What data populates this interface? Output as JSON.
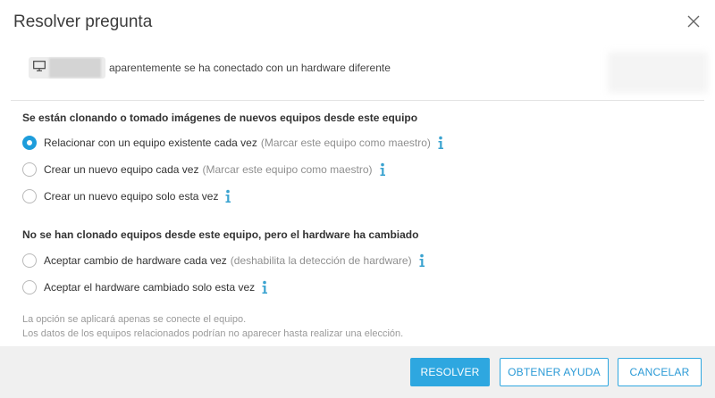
{
  "dialog": {
    "title": "Resolver pregunta",
    "close_icon": "close-icon"
  },
  "device": {
    "icon": "monitor-icon",
    "message": "aparentemente se ha conectado con un hardware diferente"
  },
  "section1": {
    "title": "Se están clonando o tomado imágenes de nuevos equipos desde este equipo",
    "options": [
      {
        "label": "Relacionar con un equipo existente cada vez",
        "hint": "(Marcar este equipo como maestro)",
        "checked": true
      },
      {
        "label": "Crear un nuevo equipo cada vez",
        "hint": "(Marcar este equipo como maestro)",
        "checked": false
      },
      {
        "label": "Crear un nuevo equipo solo esta vez",
        "hint": "",
        "checked": false
      }
    ]
  },
  "section2": {
    "title": "No se han clonado equipos desde este equipo, pero el hardware ha cambiado",
    "options": [
      {
        "label": "Aceptar cambio de hardware cada vez",
        "hint": "(deshabilita la detección de hardware)",
        "checked": false
      },
      {
        "label": "Aceptar el hardware cambiado solo esta vez",
        "hint": "",
        "checked": false
      }
    ]
  },
  "notes": {
    "line1": "La opción se aplicará apenas se conecte el equipo.",
    "line2": "Los datos de los equipos relacionados podrían no aparecer hasta realizar una elección."
  },
  "buttons": {
    "resolve": "RESOLVER",
    "help": "OBTENER AYUDA",
    "cancel": "CANCELAR"
  },
  "colors": {
    "accent": "#2ea7e0",
    "info_icon": "#3aa3d0"
  }
}
